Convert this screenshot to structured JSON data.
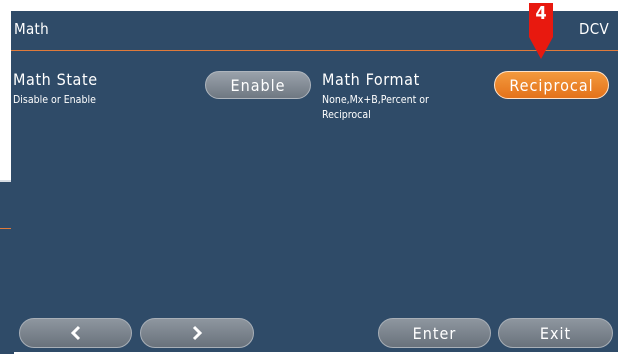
{
  "header": {
    "title": "Math",
    "mode": "DCV"
  },
  "math_state": {
    "label": "Math State",
    "description": "Disable or Enable",
    "button": "Enable"
  },
  "math_format": {
    "label": "Math Format",
    "description_line1": "None,Mx+B,Percent or",
    "description_line2": "Reciprocal",
    "button": "Reciprocal"
  },
  "softkeys": {
    "prev_icon": "chevron-left-icon",
    "next_icon": "chevron-right-icon",
    "enter": "Enter",
    "exit": "Exit"
  },
  "callout": {
    "number": "4",
    "color": "#e8190f"
  },
  "colors": {
    "background": "#2f4b68",
    "accent": "#e07a3a",
    "selected_button": "#ee8429",
    "button_grey": "#7f8891"
  }
}
